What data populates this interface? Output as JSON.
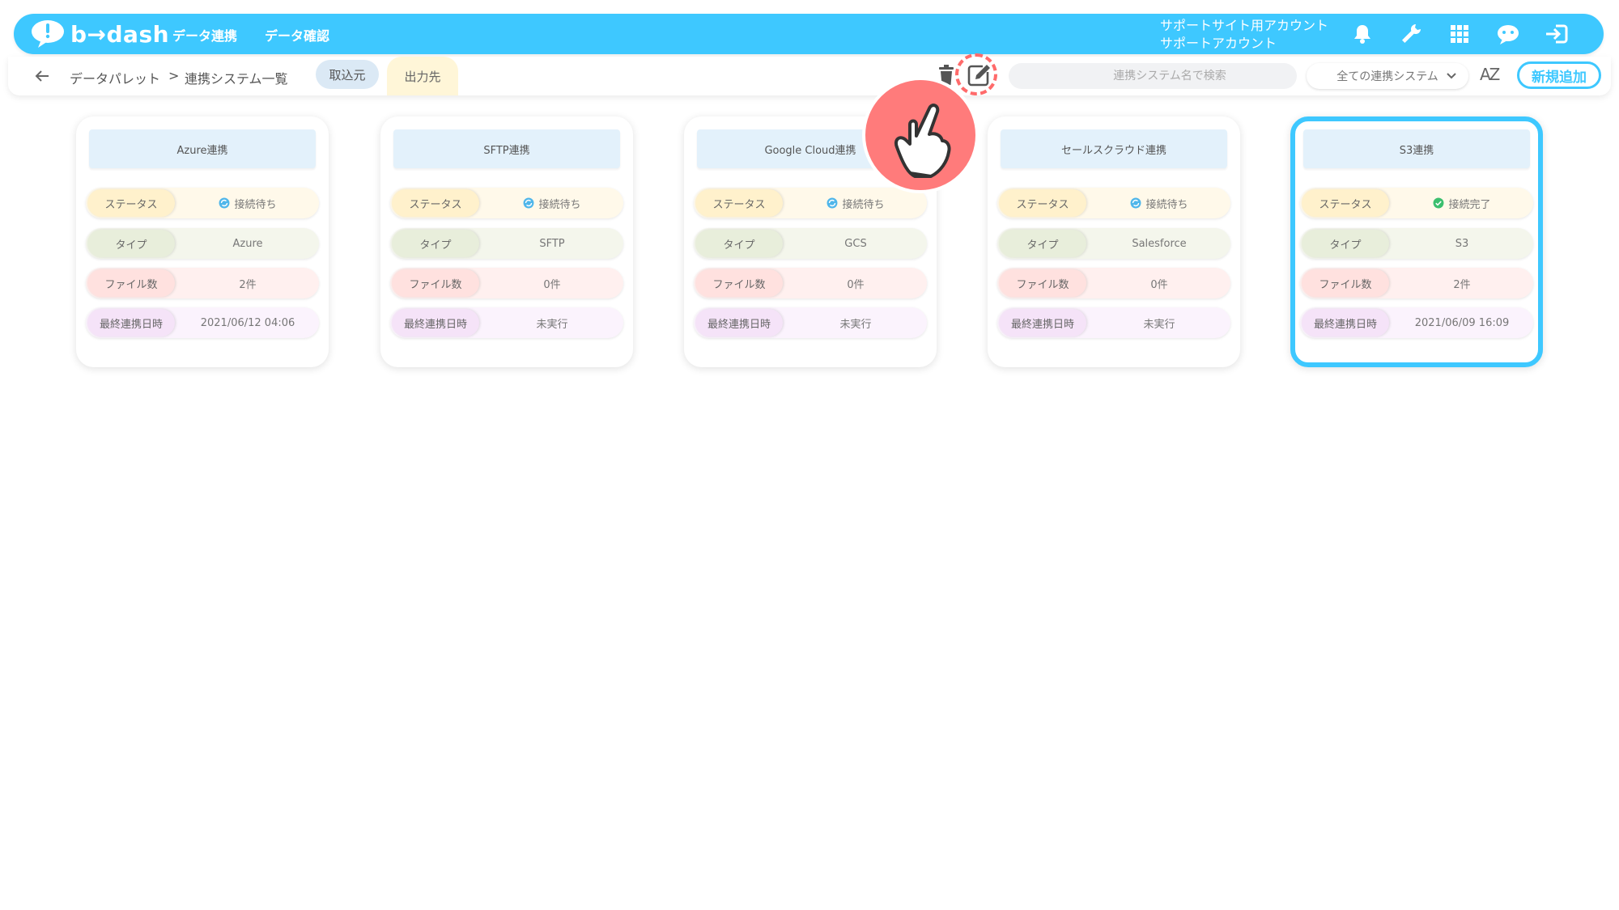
{
  "header": {
    "logo_text": "b→dash",
    "nav": [
      {
        "label": "データ連携"
      },
      {
        "label": "データ確認"
      }
    ],
    "account_line1": "サポートサイト用アカウント",
    "account_line2": "サポートアカウント"
  },
  "subbar": {
    "breadcrumb_root": "データパレット",
    "breadcrumb_sep": ">",
    "breadcrumb_current": "連携システム一覧",
    "tab_source": "取込元",
    "tab_destination": "出力先",
    "search_placeholder": "連携システム名で検索",
    "filter_selected": "全ての連携システム",
    "sort_label": "AZ",
    "new_button": "新規追加"
  },
  "row_labels": {
    "status": "ステータス",
    "type": "タイプ",
    "files": "ファイル数",
    "last_run": "最終連携日時"
  },
  "cards": [
    {
      "title": "Azure連携",
      "status": "接続待ち",
      "status_kind": "waiting",
      "type": "Azure",
      "files": "2件",
      "last_run": "2021/06/12 04:06"
    },
    {
      "title": "SFTP連携",
      "status": "接続待ち",
      "status_kind": "waiting",
      "type": "SFTP",
      "files": "0件",
      "last_run": "未実行"
    },
    {
      "title": "Google Cloud連携",
      "status": "接続待ち",
      "status_kind": "waiting",
      "type": "GCS",
      "files": "0件",
      "last_run": "未実行"
    },
    {
      "title": "セールスクラウド連携",
      "status": "接続待ち",
      "status_kind": "waiting",
      "type": "Salesforce",
      "files": "0件",
      "last_run": "未実行"
    },
    {
      "title": "S3連携",
      "status": "接続完了",
      "status_kind": "connected",
      "type": "S3",
      "files": "2件",
      "last_run": "2021/06/09 16:09",
      "selected": true
    }
  ],
  "colors": {
    "brand": "#3ec8ff",
    "highlight": "#ff6b6b",
    "waiting_icon": "#4fb6ea",
    "connected_icon": "#3bbf6e"
  },
  "icons": {
    "bell": "bell-icon",
    "wrench": "wrench-icon",
    "grid": "apps-grid-icon",
    "bot": "support-bot-icon",
    "logout": "logout-icon",
    "trash": "trash-icon",
    "edit": "edit-icon",
    "search": "search-icon",
    "pointer": "hand-pointer-icon"
  }
}
